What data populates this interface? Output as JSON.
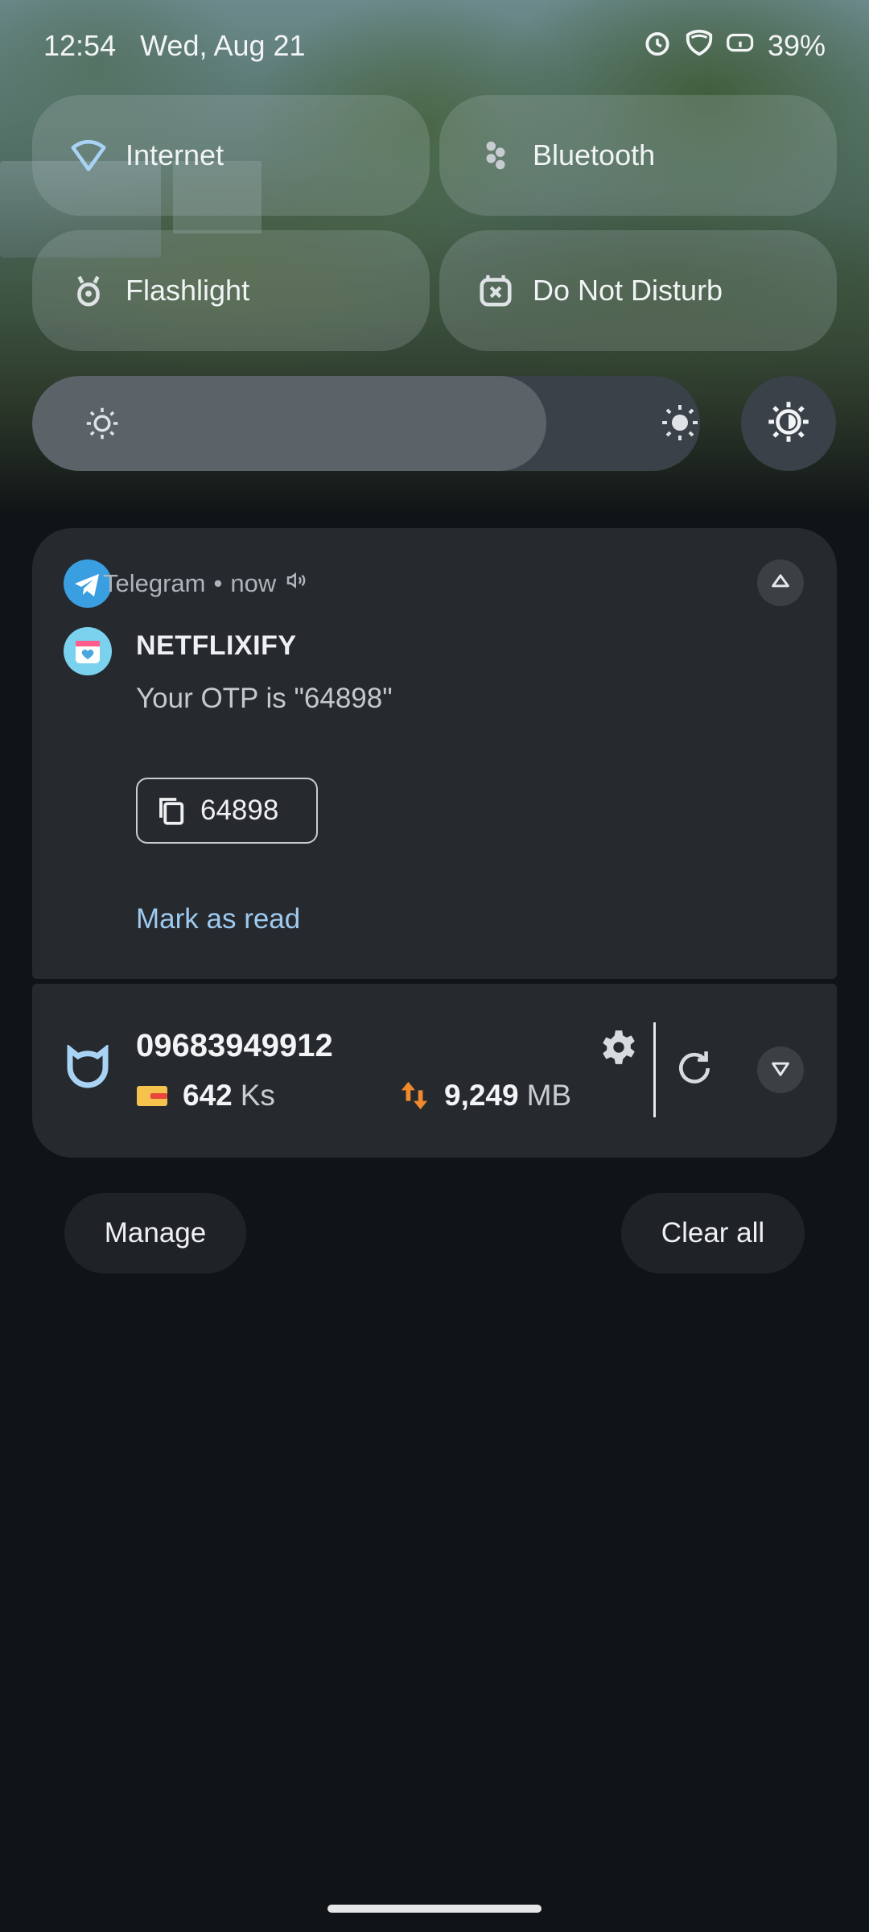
{
  "status_bar": {
    "time": "12:54",
    "date": "Wed, Aug 21",
    "battery_percent": "39%",
    "icons": [
      "alarm-icon",
      "vpn-shield-icon",
      "battery-icon"
    ]
  },
  "quick_settings": {
    "tiles": [
      {
        "label": "Internet",
        "icon": "wifi-icon"
      },
      {
        "label": "Bluetooth",
        "icon": "bluetooth-icon"
      },
      {
        "label": "Flashlight",
        "icon": "flashlight-icon"
      },
      {
        "label": "Do Not Disturb",
        "icon": "dnd-icon"
      }
    ],
    "brightness_level": 0.77
  },
  "notifications": [
    {
      "app": "Telegram",
      "time": "now",
      "title": "NETFLIXIFY",
      "body": "Your OTP is \"64898\"",
      "copy_code": "64898",
      "action": "Mark as read",
      "colors": {
        "app_icon": "#3a9fe0",
        "action": "#9ecaf0"
      }
    },
    {
      "phone_number": "09683949912",
      "balance_value": "642",
      "balance_unit": "Ks",
      "data_value": "9,249",
      "data_unit": "MB",
      "colors": {
        "wallet": "#f4c24d",
        "data_arrows": "#f08a2c"
      }
    }
  ],
  "footer": {
    "manage_label": "Manage",
    "clear_all_label": "Clear all"
  }
}
